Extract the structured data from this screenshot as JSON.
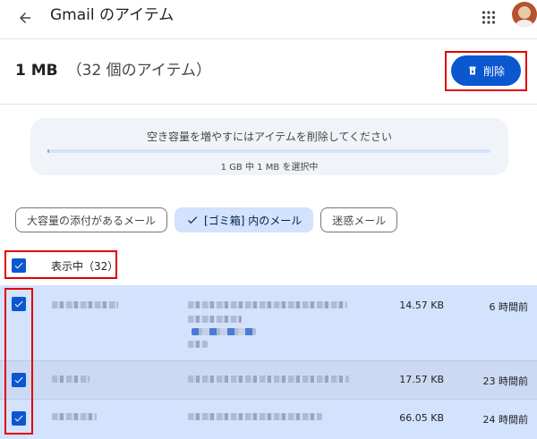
{
  "app": {
    "title": "Gmail のアイテム"
  },
  "header": {
    "size": "1 MB",
    "count_label": "（32 個のアイテム）",
    "delete_label": "削除"
  },
  "storage": {
    "message": "空き容量を増やすにはアイテムを削除してください",
    "selected_text": "1 GB 中 1 MB を選択中",
    "fill_fraction": 0.002
  },
  "filters": [
    {
      "label": "大容量の添付があるメール",
      "selected": false
    },
    {
      "label": "[ゴミ箱] 内のメール",
      "selected": true
    },
    {
      "label": "迷惑メール",
      "selected": false
    }
  ],
  "list": {
    "header_label": "表示中（32）",
    "rows": [
      {
        "size": "14.57 KB",
        "time": "6 時間前",
        "checked": true
      },
      {
        "size": "17.57 KB",
        "time": "23 時間前",
        "checked": true
      },
      {
        "size": "66.05 KB",
        "time": "24 時間前",
        "checked": true
      }
    ]
  },
  "colors": {
    "accent": "#0b57d0",
    "selected_bg": "#d3e3fd",
    "highlight": "#e00000"
  },
  "icons": {
    "back": "arrow-left-icon",
    "apps": "grid-icon",
    "delete": "trash-icon",
    "check": "check-icon"
  }
}
